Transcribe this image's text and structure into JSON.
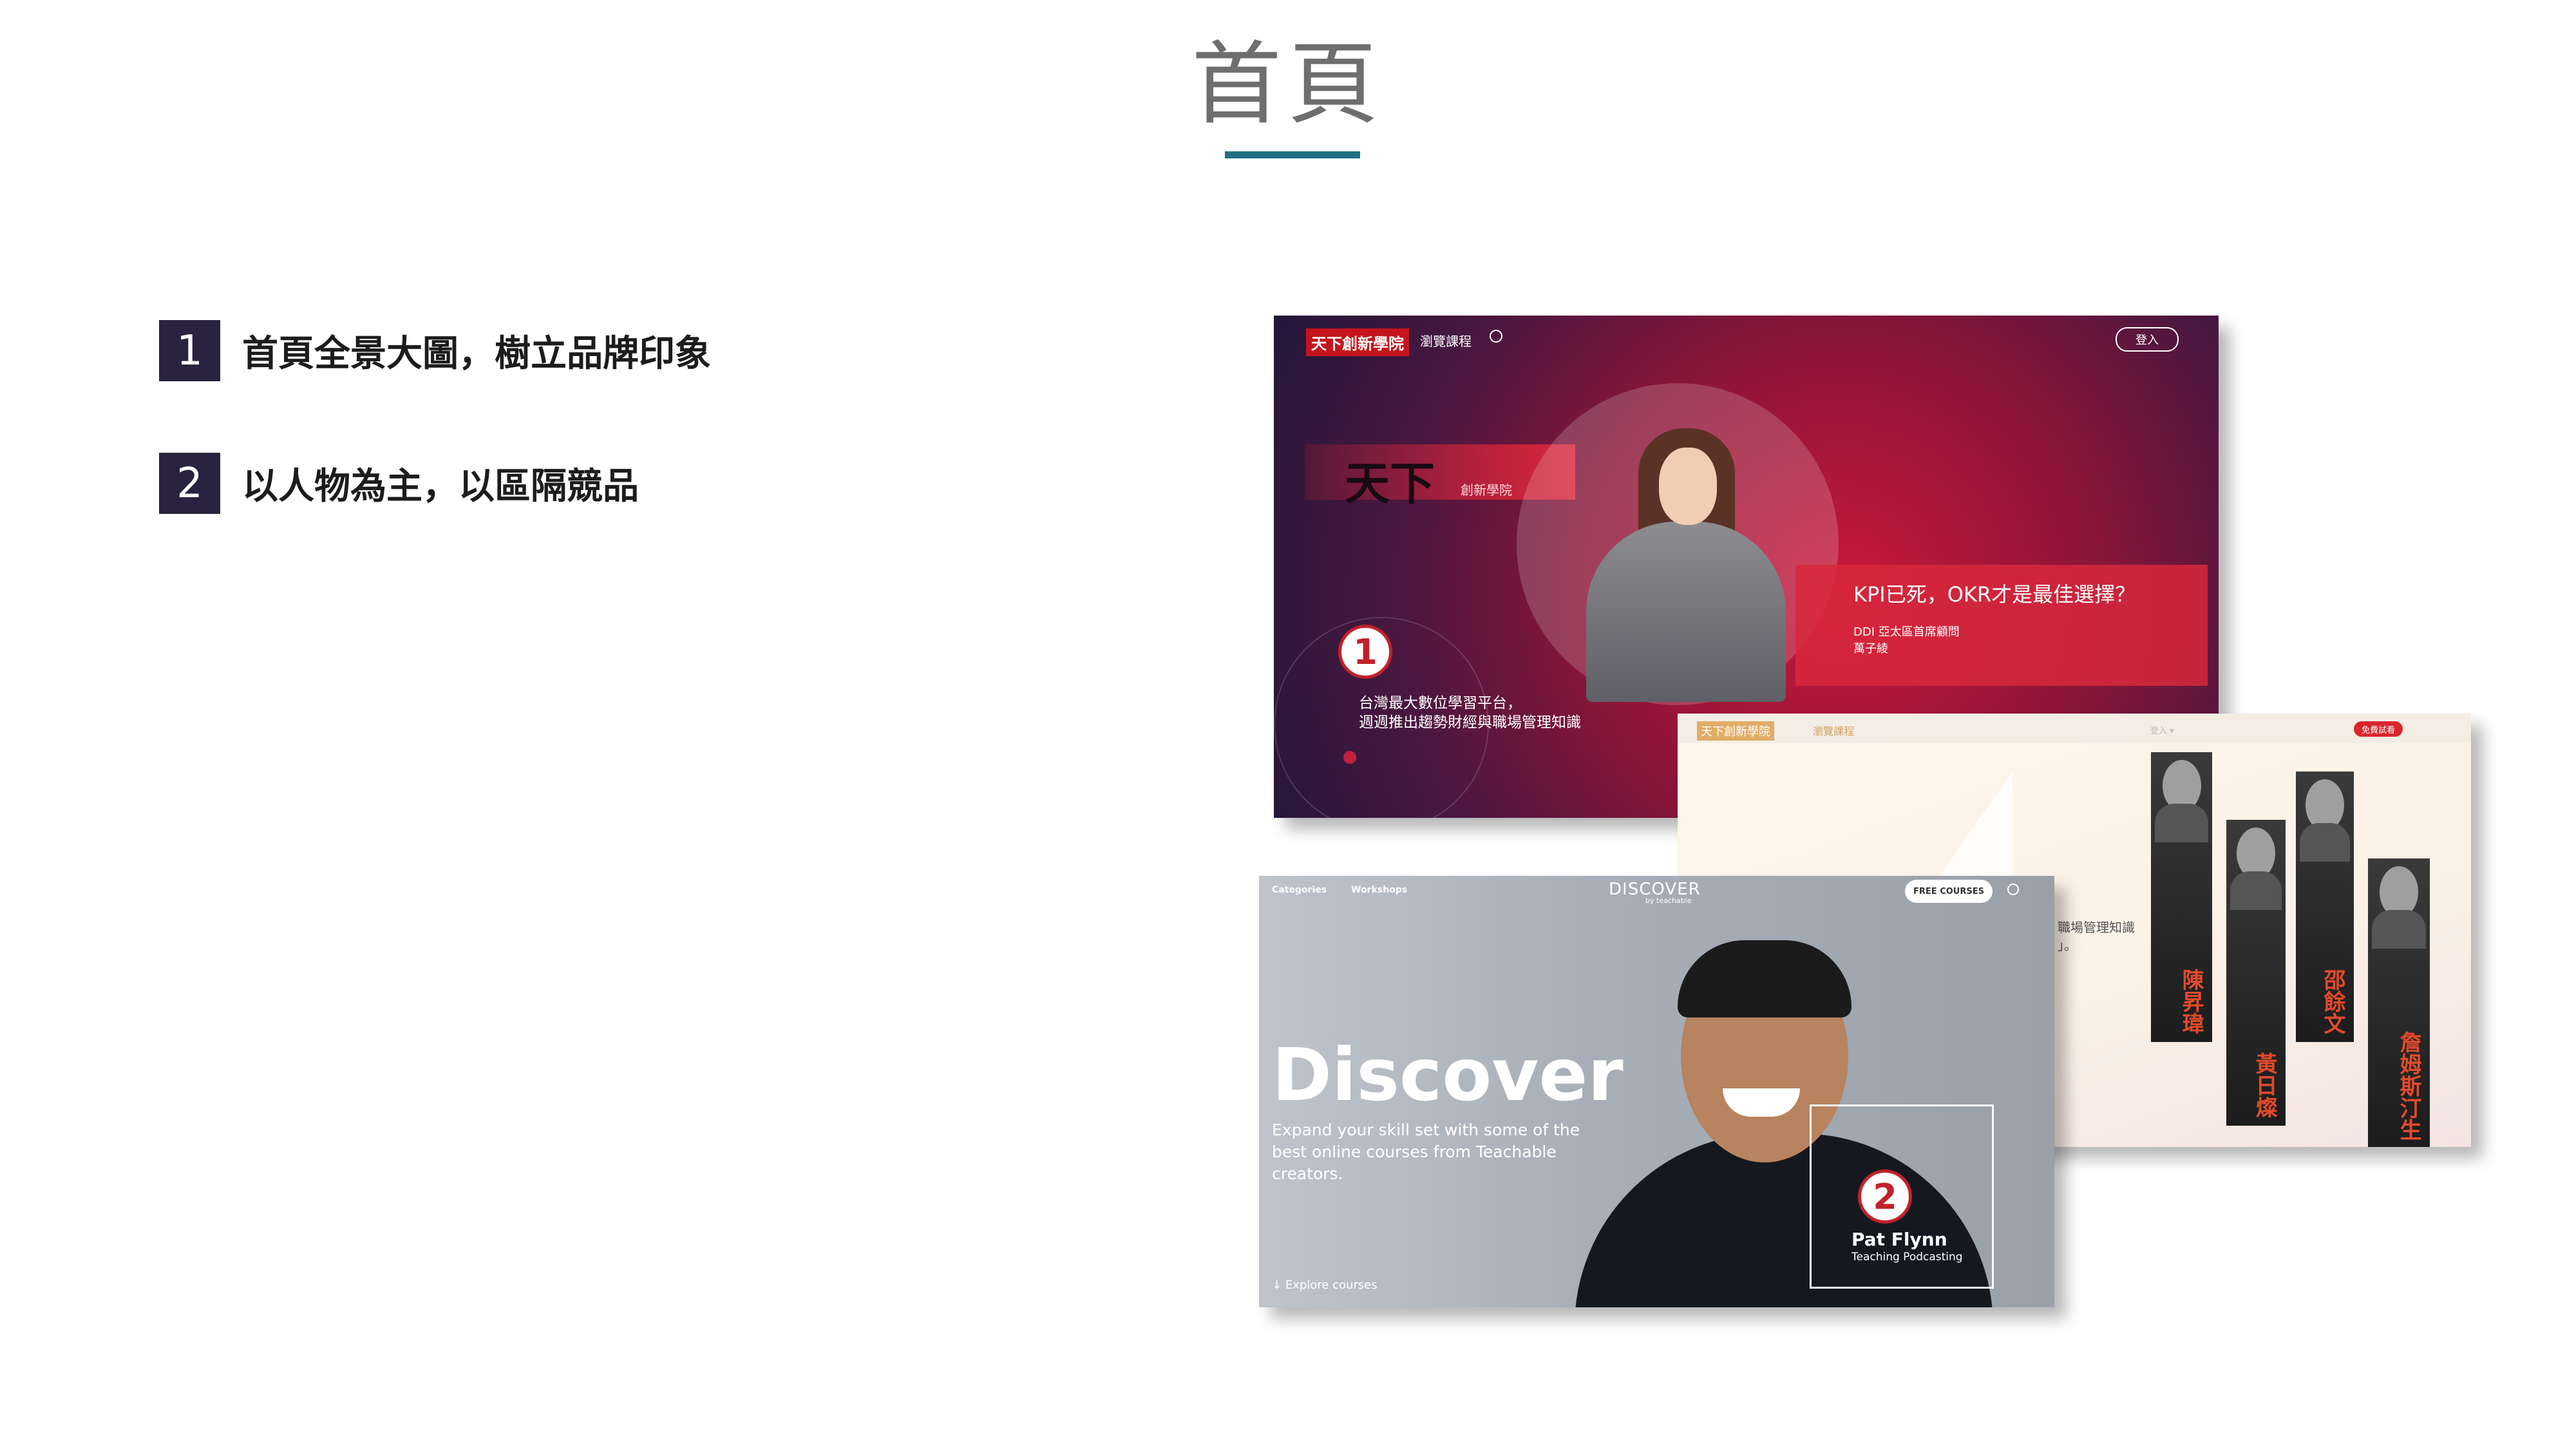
{
  "page": {
    "title": "首頁"
  },
  "bullets": [
    {
      "num": "1",
      "text": "首頁全景大圖，樹立品牌印象"
    },
    {
      "num": "2",
      "text": "以人物為主，以區隔競品"
    }
  ],
  "shot1": {
    "logo": "天下創新學院",
    "nav_browse": "瀏覽課程",
    "login": "登入",
    "brand_mark": "天下",
    "brand_sub": "創新學院",
    "quote_title": "KPI已死，OKR才是最佳選擇？",
    "quote_role": "DDI 亞太區首席顧問",
    "quote_name": "萬子綾",
    "tagline_1": "台灣最大數位學習平台，",
    "tagline_2": "週週推出趨勢財經與職場管理知識",
    "badge": "1"
  },
  "shot2": {
    "logo": "天下創新學院",
    "link": "瀏覽課程",
    "nav_right": "登入 ▾",
    "btn": "免費試看",
    "text_1": "職場管理知識",
    "text_2": "」。",
    "names": [
      "陳昇瑋",
      "黃日燦",
      "邵餘文",
      "詹姆斯汀生"
    ]
  },
  "shot3": {
    "nav_categories": "Categories",
    "nav_workshops": "Workshops",
    "logo": "DISCOVER",
    "logo_sub": "by teachable",
    "free_btn": "FREE COURSES",
    "headline": "Discover",
    "description": "Expand your skill set with some of the best online courses from Teachable creators.",
    "explore": "Explore courses",
    "person_name": "Pat Flynn",
    "person_topic": "Teaching Podcasting",
    "badge": "2"
  }
}
